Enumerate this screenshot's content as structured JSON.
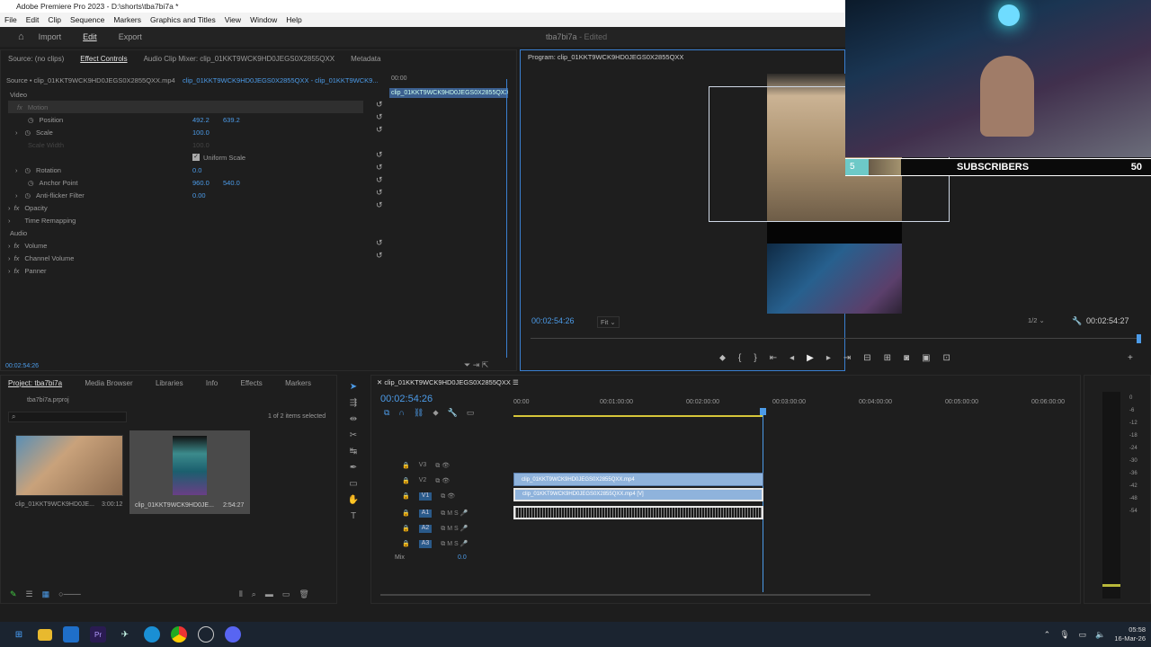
{
  "app": {
    "title": "Adobe Premiere Pro 2023 - D:\\shorts\\tba7bi7a *",
    "menu": [
      "File",
      "Edit",
      "Clip",
      "Sequence",
      "Markers",
      "Graphics and Titles",
      "View",
      "Window",
      "Help"
    ]
  },
  "workspace": {
    "tabs": [
      "Import",
      "Edit",
      "Export"
    ],
    "active": "Edit",
    "project_name": "tba7bi7a",
    "edited": "- Edited"
  },
  "effect_controls": {
    "tabs": [
      "Source: (no clips)",
      "Effect Controls",
      "Audio Clip Mixer: clip_01KKT9WCK9HD0JEGS0X2855QXX",
      "Metadata"
    ],
    "source": "Source • clip_01KKT9WCK9HD0JEGS0X2855QXX.mp4",
    "source_link": "clip_01KKT9WCK9HD0JEGS0X2855QXX - clip_01KKT9WCK9...",
    "mini_time": "00:00",
    "mini_clip": "clip_01KKT9WCK9HD0JEGS0X2855QXX",
    "video_label": "Video",
    "audio_label": "Audio",
    "props": {
      "motion": "Motion",
      "position": "Position",
      "pos_x": "492.2",
      "pos_y": "639.2",
      "scale": "Scale",
      "scale_v": "100.0",
      "scale_width": "Scale Width",
      "scale_width_v": "100.0",
      "uniform": "Uniform Scale",
      "rotation": "Rotation",
      "rotation_v": "0.0",
      "anchor": "Anchor Point",
      "anchor_x": "960.0",
      "anchor_y": "540.0",
      "antiflicker": "Anti-flicker Filter",
      "antiflicker_v": "0.00",
      "opacity": "Opacity",
      "time_remap": "Time Remapping",
      "volume": "Volume",
      "channel_volume": "Channel Volume",
      "panner": "Panner"
    },
    "timecode": "00:02:54:26"
  },
  "program": {
    "title": "Program: clip_01KKT9WCK9HD0JEGS0X2855QXX",
    "timecode": "00:02:54:26",
    "fit": "Fit",
    "resolution": "1/2",
    "duration": "00:02:54:27"
  },
  "overlay": {
    "count_left": "5",
    "label": "SUBSCRIBERS",
    "count_right": "50"
  },
  "project": {
    "tabs": [
      "Project: tba7bi7a",
      "Media Browser",
      "Libraries",
      "Info",
      "Effects",
      "Markers"
    ],
    "file": "tba7bi7a.prproj",
    "selected": "1 of 2 items selected",
    "items": [
      {
        "name": "clip_01KKT9WCK9HD0JE...",
        "duration": "3:00:12"
      },
      {
        "name": "clip_01KKT9WCK9HD0JE...",
        "duration": "2:54:27"
      }
    ]
  },
  "timeline": {
    "tab": "clip_01KKT9WCK9HD0JEGS0X2855QXX",
    "timecode": "00:02:54:26",
    "ruler": [
      "00:00",
      "00:01:00:00",
      "00:02:00:00",
      "00:03:00:00",
      "00:04:00:00",
      "00:05:00:00",
      "00:06:00:00"
    ],
    "tracks": [
      "V3",
      "V2",
      "V1",
      "A1",
      "A2",
      "A3"
    ],
    "mix": "Mix",
    "mix_v": "0.0",
    "clip_v2": "clip_01KKT9WCK9HD0JEGS0X2855QXX.mp4",
    "clip_v1": "clip_01KKT9WCK9HD0JEGS0X2855QXX.mp4 [V]"
  },
  "meter": [
    "0",
    "-6",
    "-12",
    "-18",
    "-24",
    "-30",
    "-36",
    "-42",
    "-48",
    "-54"
  ],
  "taskbar": {
    "time": "05:58",
    "date": "16-Mar-26"
  }
}
